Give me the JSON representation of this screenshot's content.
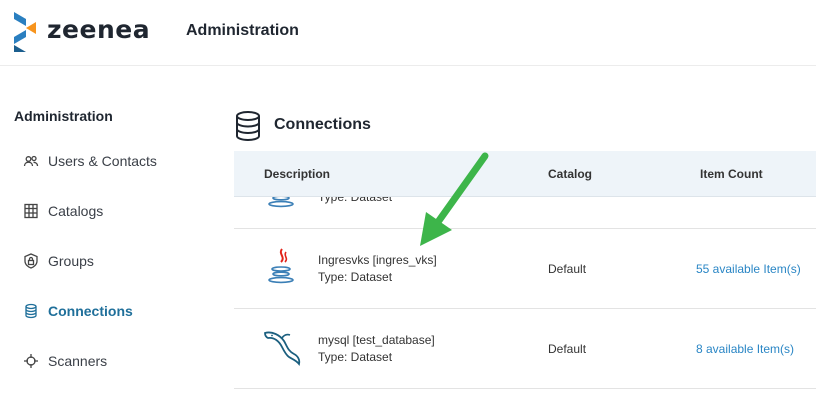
{
  "header": {
    "brand": "zeenea",
    "title": "Administration"
  },
  "sidebar": {
    "heading": "Administration",
    "items": [
      {
        "label": "Users & Contacts",
        "icon": "users-icon",
        "active": false
      },
      {
        "label": "Catalogs",
        "icon": "catalog-icon",
        "active": false
      },
      {
        "label": "Groups",
        "icon": "lock-icon",
        "active": false
      },
      {
        "label": "Connections",
        "icon": "database-icon",
        "active": true
      },
      {
        "label": "Scanners",
        "icon": "crosshair-icon",
        "active": false
      }
    ]
  },
  "main": {
    "title": "Connections",
    "columns": [
      "Description",
      "Catalog",
      "Item Count"
    ],
    "rows": [
      {
        "name": "",
        "type": "Type: Dataset",
        "catalog": "",
        "count": "",
        "icon": "java-icon"
      },
      {
        "name": "Ingresvks [ingres_vks]",
        "type": "Type: Dataset",
        "catalog": "Default",
        "count": "55 available Item(s)",
        "icon": "java-icon"
      },
      {
        "name": "mysql [test_database]",
        "type": "Type: Dataset",
        "catalog": "Default",
        "count": "8 available Item(s)",
        "icon": "mysql-icon"
      }
    ]
  },
  "colors": {
    "accent": "#1f6f9a",
    "link": "#2a86c5",
    "header_bg": "#eef4f9",
    "arrow": "#3db54a",
    "logo_blue": "#2a7fc0",
    "logo_orange": "#f7941d"
  }
}
